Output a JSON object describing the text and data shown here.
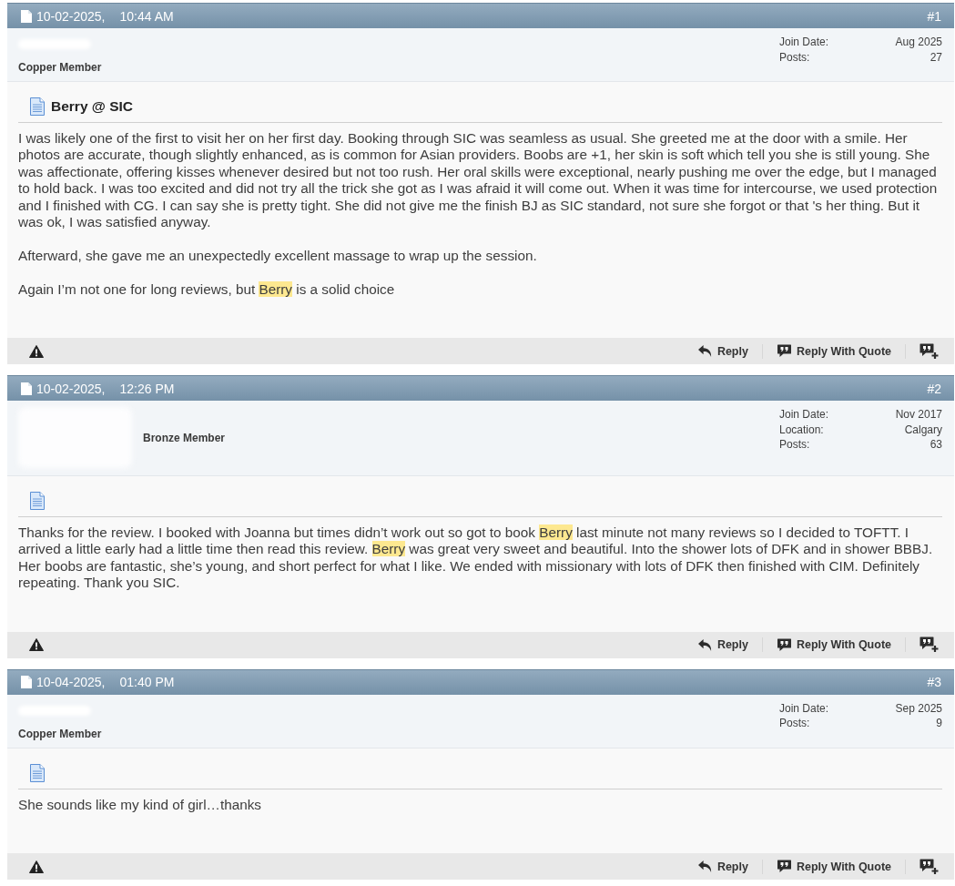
{
  "posts": [
    {
      "date": "10-02-2025,",
      "time": "10:44 AM",
      "number": "#1",
      "user": {
        "avatar": false,
        "rank": "Copper Member",
        "stats": [
          {
            "label": "Join Date:",
            "value": "Aug 2025"
          },
          {
            "label": "Posts:",
            "value": "27"
          }
        ]
      },
      "title": "Berry @ SIC",
      "paragraphs": [
        [
          {
            "text": "I was likely one of the first to visit her on her first day. Booking through SIC was seamless as usual. She greeted me at the door with a smile. Her photos are accurate, though slightly enhanced, as is common for Asian providers. Boobs are +1, her skin is soft which tell you she is still young. She was affectionate, offering kisses whenever desired but not too rush. Her oral skills were exceptional, nearly pushing me over the edge, but I managed to hold back. I was too excited and did not try all the trick she got as I was afraid it will come out. When it was time for intercourse, we used protection and I finished with CG. I can say she is pretty tight. She did not give me the finish BJ as SIC standard, not sure she forgot or that 's her thing. But it was ok, I was satisfied anyway.",
            "highlighted": false
          }
        ],
        [
          {
            "text": "Afterward, she gave me an unexpectedly excellent massage to wrap up the session.",
            "highlighted": false
          }
        ],
        [
          {
            "text": "Again I’m not one for long reviews, but ",
            "highlighted": false
          },
          {
            "text": "Berry",
            "highlighted": true
          },
          {
            "text": " is a solid choice",
            "highlighted": false
          }
        ]
      ],
      "actions": [
        {
          "kind": "reply",
          "label": "Reply"
        },
        {
          "kind": "quote",
          "label": "Reply With Quote"
        }
      ]
    },
    {
      "date": "10-02-2025,",
      "time": "12:26 PM",
      "number": "#2",
      "user": {
        "avatar": true,
        "rank": "Bronze Member",
        "stats": [
          {
            "label": "Join Date:",
            "value": "Nov 2017"
          },
          {
            "label": "Location:",
            "value": "Calgary"
          },
          {
            "label": "Posts:",
            "value": "63"
          }
        ]
      },
      "paragraphs": [
        [
          {
            "text": "Thanks for the review. I booked with Joanna but times didn’t work out so got to book ",
            "highlighted": false
          },
          {
            "text": "Berry",
            "highlighted": true
          },
          {
            "text": " last minute not many reviews so I decided to TOFTT. I arrived a little early had a little time then read this review. ",
            "highlighted": false
          },
          {
            "text": "Berry",
            "highlighted": true
          },
          {
            "text": " was great very sweet and beautiful. Into the shower lots of DFK and in shower BBBJ. Her boobs are fantastic, she’s young, and short perfect for what I like. We ended with missionary with lots of DFK then finished with CIM. Definitely repeating. Thank you SIC.",
            "highlighted": false
          }
        ]
      ],
      "actions": [
        {
          "kind": "reply",
          "label": "Reply"
        },
        {
          "kind": "quote",
          "label": "Reply With Quote"
        }
      ]
    },
    {
      "date": "10-04-2025,",
      "time": "01:40 PM",
      "number": "#3",
      "user": {
        "avatar": false,
        "rank": "Copper Member",
        "stats": [
          {
            "label": "Join Date:",
            "value": "Sep 2025"
          },
          {
            "label": "Posts:",
            "value": "9"
          }
        ]
      },
      "paragraphs": [
        [
          {
            "text": "She sounds like my kind of girl…thanks",
            "highlighted": false
          }
        ]
      ],
      "actions": [
        {
          "kind": "reply",
          "label": "Reply"
        },
        {
          "kind": "quote",
          "label": "Reply With Quote"
        }
      ]
    }
  ]
}
